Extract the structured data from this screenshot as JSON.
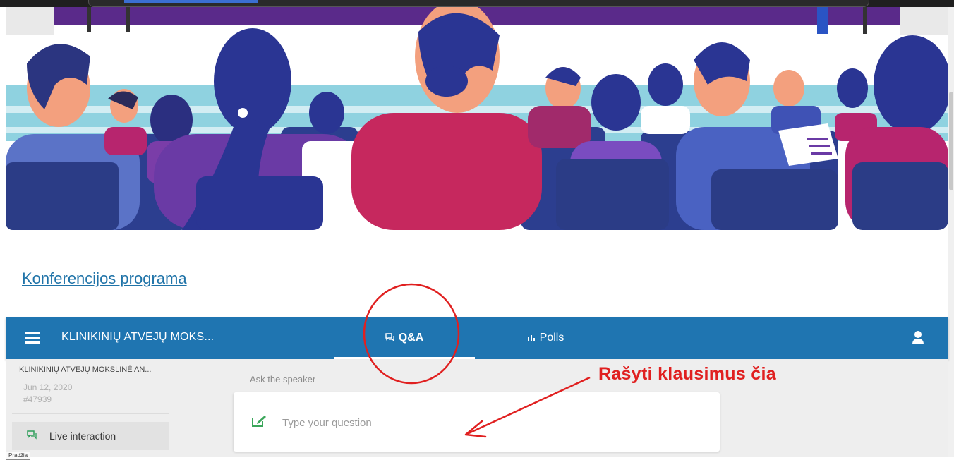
{
  "program_link": "Konferencijos programa",
  "navbar": {
    "title": "KLINIKINIŲ ATVEJŲ MOKS...",
    "tabs": [
      {
        "label": "Q&A",
        "icon": "chat-icon",
        "active": true
      },
      {
        "label": "Polls",
        "icon": "bar-chart-icon",
        "active": false
      }
    ],
    "user_icon": "person-icon"
  },
  "sidebar": {
    "event_title": "KLINIKINIŲ ATVEJŲ MOKSLINĖ AN...",
    "date": "Jun 12, 2020",
    "event_id": "#47939",
    "item_label": "Live interaction"
  },
  "question": {
    "ask_label": "Ask the speaker",
    "placeholder": "Type your question"
  },
  "annotation": {
    "text": "Rašyti klausimus čia",
    "color": "#e02020"
  },
  "tooltip": "Pradžia",
  "colors": {
    "navbar": "#1f75b1",
    "link": "#1f73a8",
    "accent_green": "#2e9e5a"
  }
}
